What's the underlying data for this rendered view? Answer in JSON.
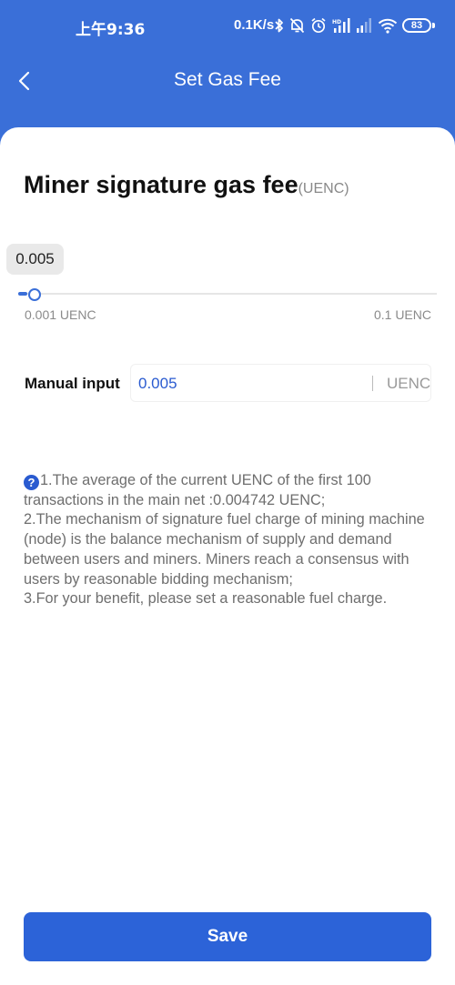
{
  "status_bar": {
    "time": "上午9:36",
    "network_speed": "0.1K/s",
    "icons": [
      "bluetooth-icon",
      "mute-icon",
      "alarm-icon",
      "signal-icon",
      "signal-weak-icon",
      "wifi-icon"
    ],
    "battery": "83"
  },
  "header": {
    "title": "Set Gas Fee",
    "back_icon": "chevron-left-icon",
    "color": "#3a6fd8"
  },
  "fee_section": {
    "title": "Miner signature gas fee",
    "unit_suffix": "(UENC)"
  },
  "slider": {
    "tooltip_value": "0.005",
    "min_label": "0.001 UENC",
    "max_label": "0.1 UENC",
    "min": 0.001,
    "max": 0.1,
    "value": 0.005
  },
  "manual_input": {
    "label": "Manual input",
    "value": "0.005",
    "unit": "UENC"
  },
  "notes": {
    "help_icon": "question-circle-icon",
    "help_glyph": "?",
    "lines": [
      "1.The average of the current UENC of the first 100 transactions in the main net :0.004742 UENC;",
      "2.The mechanism of signature fuel charge of mining machine (node) is the balance mechanism of supply and demand between users and miners. Miners reach a consensus with users by reasonable bidding mechanism;",
      "3.For your benefit, please set a reasonable fuel charge."
    ]
  },
  "footer": {
    "save_label": "Save",
    "accent": "#2c63d8"
  }
}
